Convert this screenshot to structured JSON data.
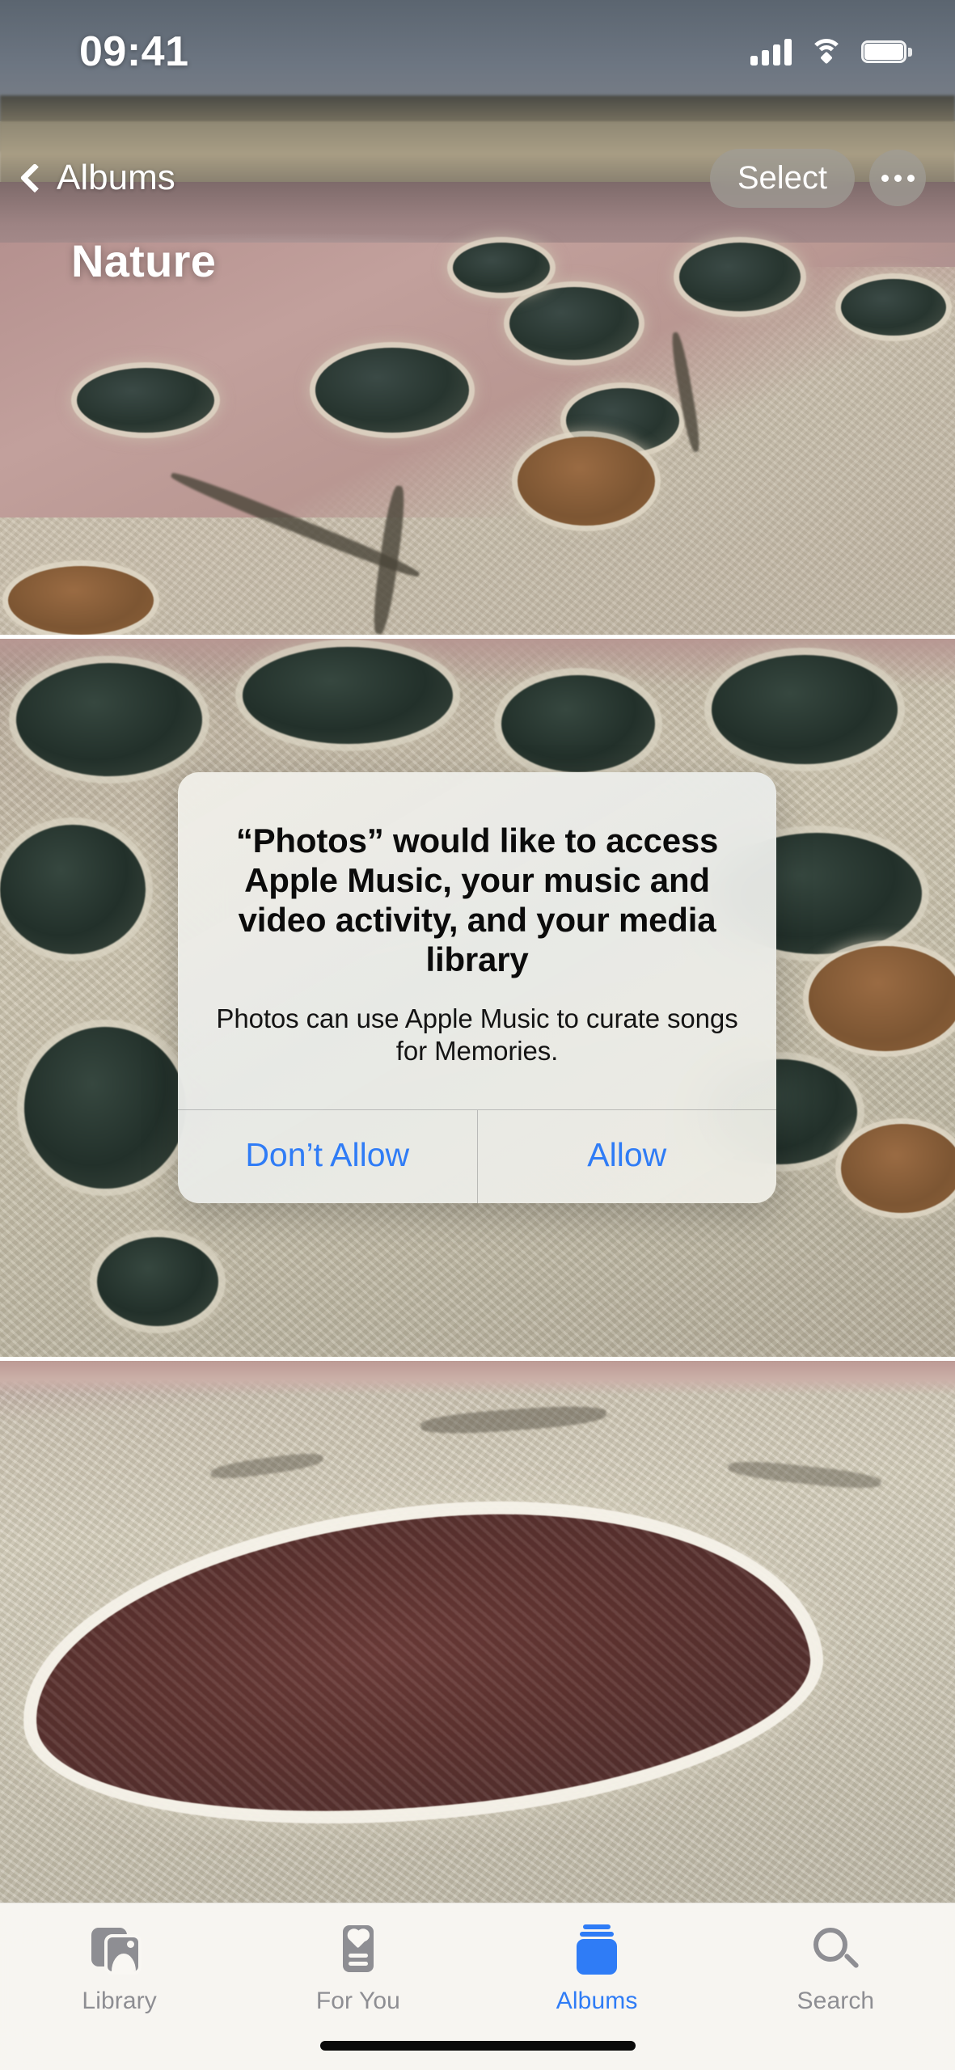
{
  "status_bar": {
    "time": "09:41",
    "cellular_icon": "cellular-bars-icon",
    "wifi_icon": "wifi-icon",
    "battery_icon": "battery-full-icon"
  },
  "nav_bar": {
    "back_label": "Albums",
    "back_icon": "chevron-left-icon",
    "select_label": "Select",
    "more_icon": "ellipsis-icon"
  },
  "album": {
    "title": "Nature",
    "photo_count_visible": 3
  },
  "alert": {
    "title": "“Photos” would like to access Apple Music, your music and video activity, and your media library",
    "message": "Photos can use Apple Music to curate songs for Memories.",
    "dont_allow_label": "Don’t Allow",
    "allow_label": "Allow",
    "accent_color": "#2f7cf6"
  },
  "tab_bar": {
    "items": [
      {
        "label": "Library",
        "icon": "library-icon",
        "active": false
      },
      {
        "label": "For You",
        "icon": "for-you-icon",
        "active": false
      },
      {
        "label": "Albums",
        "icon": "albums-icon",
        "active": true
      },
      {
        "label": "Search",
        "icon": "search-icon",
        "active": false
      }
    ],
    "active_color": "#2f7cf6",
    "inactive_color": "#8e8e93"
  }
}
